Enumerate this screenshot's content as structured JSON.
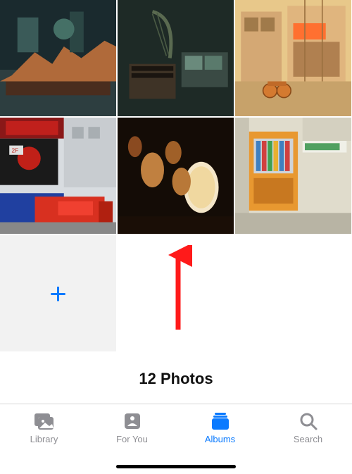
{
  "grid": {
    "photo_count_label": "12 Photos",
    "add_icon_glyph": "+"
  },
  "tabs": {
    "library": "Library",
    "for_you": "For You",
    "albums": "Albums",
    "search": "Search",
    "active": "albums"
  },
  "colors": {
    "accent": "#0a7aff",
    "inactive": "#8e8e93",
    "arrow": "#ff1a1a"
  }
}
